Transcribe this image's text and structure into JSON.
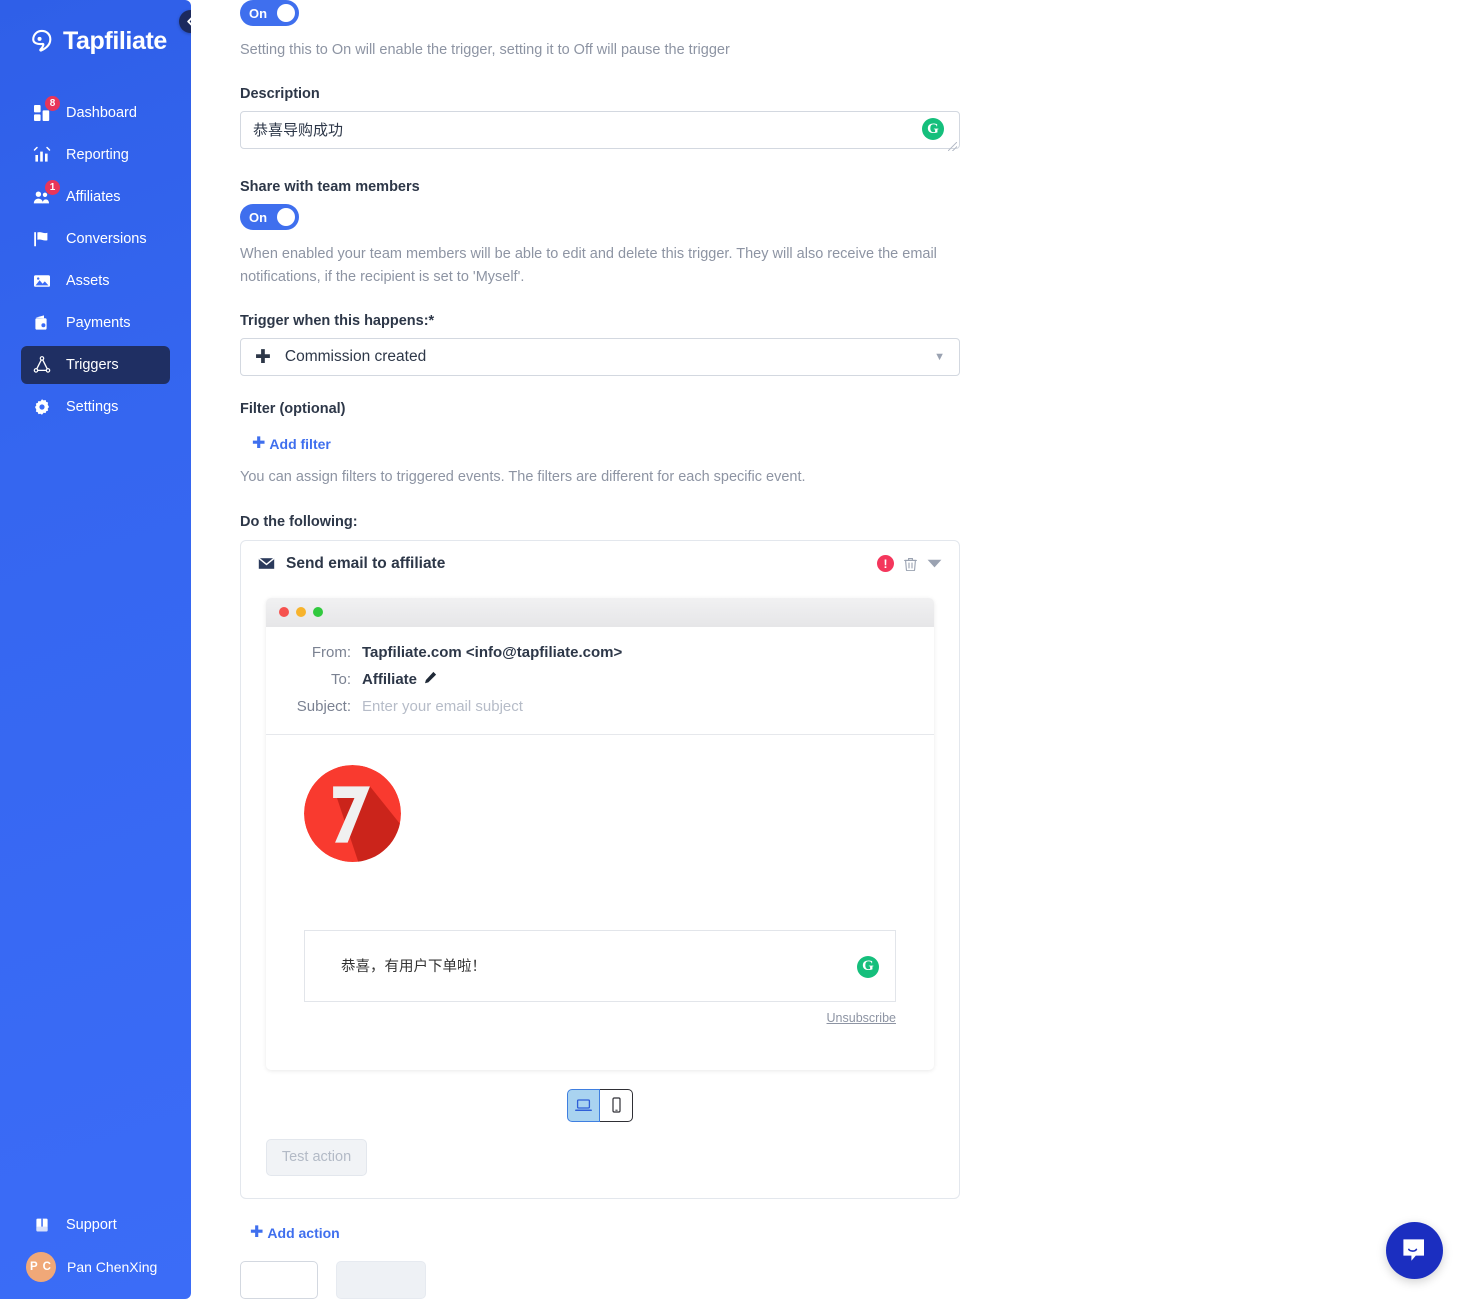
{
  "sidebar": {
    "brand": "Tapfiliate",
    "collapse_icon": "chevron-left-icon",
    "items": [
      {
        "label": "Dashboard",
        "icon": "dashboard-icon",
        "badge": "8",
        "active": false
      },
      {
        "label": "Reporting",
        "icon": "bar-chart-icon",
        "badge": "",
        "active": false
      },
      {
        "label": "Affiliates",
        "icon": "people-icon",
        "badge": "1",
        "active": false
      },
      {
        "label": "Conversions",
        "icon": "flag-icon",
        "badge": "",
        "active": false
      },
      {
        "label": "Assets",
        "icon": "image-icon",
        "badge": "",
        "active": false
      },
      {
        "label": "Payments",
        "icon": "wallet-icon",
        "badge": "",
        "active": false
      },
      {
        "label": "Triggers",
        "icon": "triangle-node-icon",
        "badge": "",
        "active": true
      },
      {
        "label": "Settings",
        "icon": "gear-icon",
        "badge": "",
        "active": false
      }
    ],
    "support": {
      "label": "Support",
      "icon": "book-icon"
    },
    "user": {
      "initials": "P C",
      "name": "Pan ChenXing"
    },
    "colors": {
      "bg_start": "#2f5fe8",
      "bg_end": "#3b6cf7",
      "active_bg": "#1f2f63",
      "badge": "#e8355a",
      "avatar": "#f0a878"
    }
  },
  "form": {
    "status_toggle": {
      "label": "On",
      "state": "on"
    },
    "status_hint": "Setting this to On will enable the trigger, setting it to Off will pause the trigger",
    "description_label": "Description",
    "description_value": "恭喜导购成功",
    "description_placeholder": "",
    "grammarly_glyph": "G",
    "share_label": "Share with team members",
    "share_toggle": {
      "label": "On",
      "state": "on"
    },
    "share_hint": "When enabled your team members will be able to edit and delete this trigger. They will also receive the email notifications, if the recipient is set to 'Myself'.",
    "trigger_label": "Trigger when this happens:*",
    "trigger_value": "Commission created",
    "trigger_plus": "✚",
    "trigger_caret": "▼",
    "filter_label": "Filter (optional)",
    "add_filter_label": "Add filter",
    "add_filter_plus": "✚",
    "filter_hint": "You can assign filters to triggered events. The filters are different for each specific event.",
    "do_following_label": "Do the following:"
  },
  "action": {
    "title": "Send email to affiliate",
    "mail_icon": "envelope-icon",
    "alert_icon": "alert-exclamation-icon",
    "alert_glyph": "!",
    "trash_icon": "trash-icon",
    "collapse_icon": "caret-down-icon",
    "email": {
      "from_label": "From:",
      "from_value": "Tapfiliate.com <info@tapfiliate.com>",
      "to_label": "To:",
      "to_value": "Affiliate",
      "edit_icon": "pencil-icon",
      "subject_label": "Subject:",
      "subject_value": "",
      "subject_placeholder": "Enter your email subject",
      "logo_icon": "red-seven-logo",
      "logo_digit": "7",
      "body_text": "恭喜，有用户下单啦！",
      "grammarly_glyph": "G",
      "unsubscribe_label": "Unsubscribe"
    },
    "device_toggle": {
      "desktop_icon": "laptop-icon",
      "mobile_icon": "phone-icon",
      "selected": "desktop"
    },
    "test_button_label": "Test action"
  },
  "footer": {
    "add_action_label": "Add action",
    "add_action_plus": "✚",
    "buttons": [
      {
        "label": "",
        "style": "outline"
      },
      {
        "label": "",
        "style": "filled"
      }
    ]
  },
  "widgets": {
    "intercom_icon": "chat-bubble-icon"
  }
}
